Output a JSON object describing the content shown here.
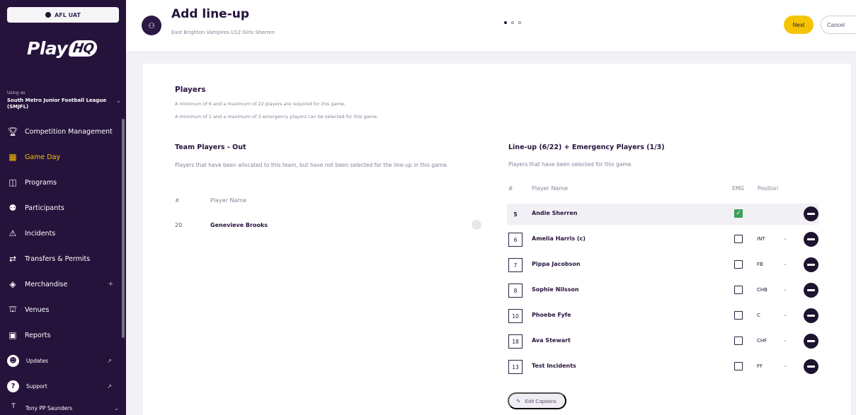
{
  "env_label": "AFL UAT",
  "logo_text": "Play",
  "logo_hq": "HQ",
  "org": {
    "caption": "Using as",
    "name": "South Metro Junior Football League (SMJFL)"
  },
  "nav": [
    {
      "label": "Competition Management",
      "icon": "trophy-icon"
    },
    {
      "label": "Game Day",
      "icon": "game-day-icon",
      "active": true
    },
    {
      "label": "Programs",
      "icon": "programs-icon"
    },
    {
      "label": "Participants",
      "icon": "participants-icon"
    },
    {
      "label": "Incidents",
      "icon": "warning-icon"
    },
    {
      "label": "Transfers & Permits",
      "icon": "transfer-icon"
    },
    {
      "label": "Merchandise",
      "icon": "merchandise-icon",
      "expandable": true
    },
    {
      "label": "Venues",
      "icon": "venues-icon"
    },
    {
      "label": "Reports",
      "icon": "reports-icon"
    }
  ],
  "external": [
    {
      "label": "Updates",
      "icon": "updates-icon"
    },
    {
      "label": "Support",
      "icon": "help-icon"
    }
  ],
  "user": {
    "initial": "T",
    "name": "Tony PP Saunders"
  },
  "header": {
    "title": "Add line-up",
    "subtitle": "East Brighton Vampires U12 Girls Sherren",
    "next_label": "Next",
    "cancel_label": "Cancel"
  },
  "players_section": {
    "title": "Players",
    "note1": "A minimum of 6 and a maximum of 22 players are required for this game.",
    "note2": "A minimum of 1 and a maximum of 3 emergency players can be selected for this game."
  },
  "team_out": {
    "title": "Team Players - Out",
    "description": "Players that have been allocated to this team, but have not been selected for the line-up in this game.",
    "col_hash": "#",
    "col_name": "Player Name",
    "rows": [
      {
        "number": "20",
        "name": "Genevieve Brooks"
      }
    ]
  },
  "lineup": {
    "title": "Line-up (6/22) + Emergency Players (1/3)",
    "description": "Players that have been selected for this game.",
    "col_hash": "#",
    "col_name": "Player Name",
    "col_emg": "EMG",
    "col_position": "Position",
    "rows": [
      {
        "number": "5",
        "name": "Andie Sherren",
        "emg": true,
        "position": ""
      },
      {
        "number": "6",
        "name": "Amelia Harris (c)",
        "emg": false,
        "position": "INT"
      },
      {
        "number": "7",
        "name": "Pippa Jacobson",
        "emg": false,
        "position": "FB"
      },
      {
        "number": "8",
        "name": "Sophie Nilsson",
        "emg": false,
        "position": "CHB"
      },
      {
        "number": "10",
        "name": "Phoebe Fyfe",
        "emg": false,
        "position": "C"
      },
      {
        "number": "18",
        "name": "Ava Stewart",
        "emg": false,
        "position": "CHF"
      },
      {
        "number": "13",
        "name": "Test Incidents",
        "emg": false,
        "position": "FF"
      }
    ],
    "edit_captains_label": "Edit Captains"
  },
  "colors": {
    "sidebar": "#26133c",
    "accent": "#f5c400",
    "check": "#3aa05c"
  }
}
